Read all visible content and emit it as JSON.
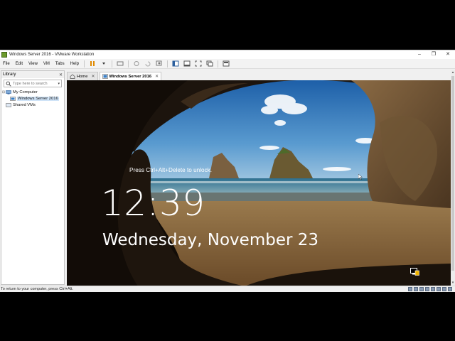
{
  "window": {
    "title": "Windows Server 2016 - VMware Workstation",
    "controls": {
      "minimize": "–",
      "maximize": "❐",
      "close": "✕"
    }
  },
  "menu": [
    "File",
    "Edit",
    "View",
    "VM",
    "Tabs",
    "Help"
  ],
  "library": {
    "title": "Library",
    "close": "✕",
    "search_placeholder": "Type here to search",
    "dropdown": "▾",
    "tree": [
      {
        "label": "My Computer",
        "expander": "⊟"
      },
      {
        "label": "Windows Server 2016"
      },
      {
        "label": "Shared VMs"
      }
    ]
  },
  "tabs": [
    {
      "label": "Home",
      "close": "✕"
    },
    {
      "label": "Windows Server 2016",
      "close": "✕"
    }
  ],
  "vm_screen": {
    "unlock_hint": "Press Ctrl+Alt+Delete to unlock.",
    "time": "12:39",
    "date": "Wednesday, November 23"
  },
  "status": {
    "text": "To return to your computer, press Ctrl+Alt."
  },
  "scroll": {
    "up": "▴",
    "down": "▾"
  },
  "colors": {
    "accent": "#3b7fc4",
    "chrome": "#f0f0f0",
    "status_icon": "#8a9bb3"
  }
}
